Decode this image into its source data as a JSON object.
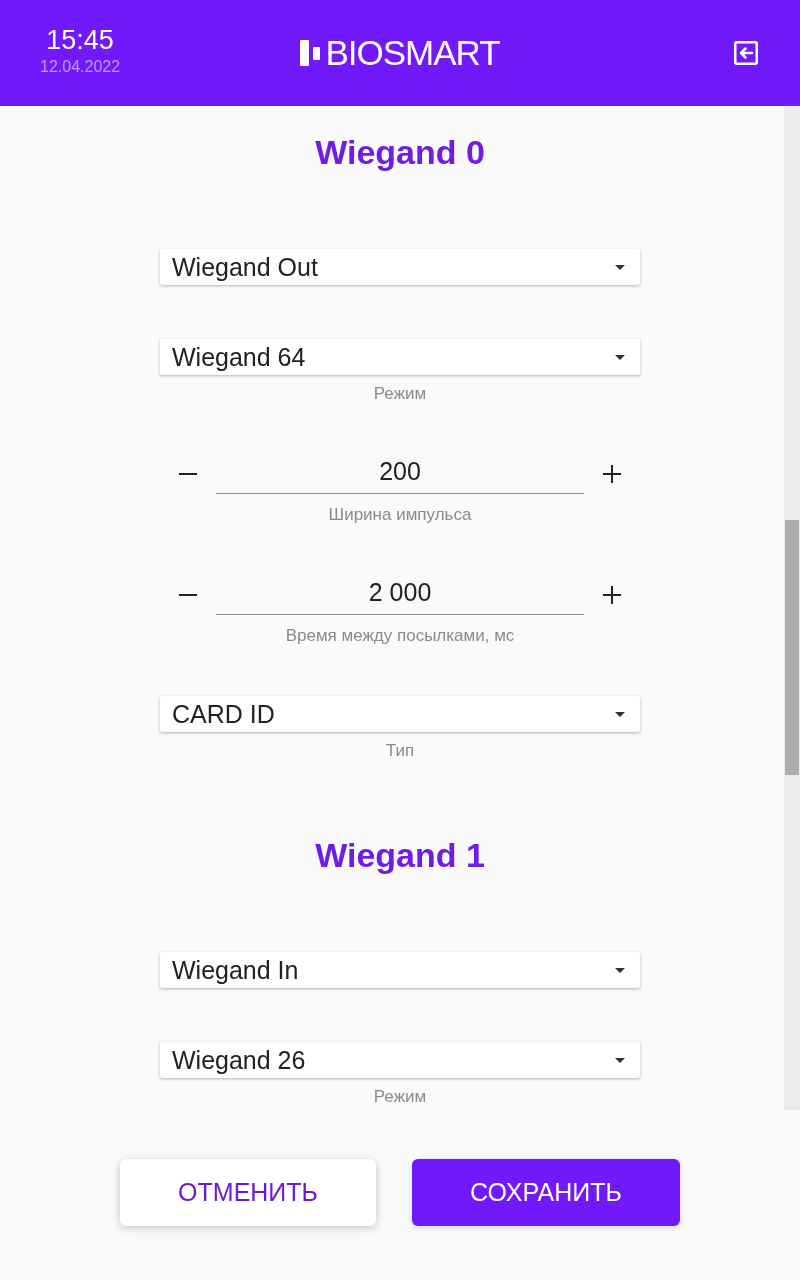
{
  "header": {
    "time": "15:45",
    "date": "12.04.2022",
    "logo": "BIOSMART"
  },
  "sections": [
    {
      "title": "Wiegand 0",
      "fields": [
        {
          "kind": "select",
          "value": "Wiegand Out"
        },
        {
          "kind": "select",
          "value": "Wiegand 64",
          "caption": "Режим"
        },
        {
          "kind": "stepper",
          "value": "200",
          "caption": "Ширина импульса"
        },
        {
          "kind": "stepper",
          "value": "2 000",
          "caption": "Время между посылками, мс"
        },
        {
          "kind": "select",
          "value": "CARD ID",
          "caption": "Тип"
        }
      ]
    },
    {
      "title": "Wiegand 1",
      "fields": [
        {
          "kind": "select",
          "value": "Wiegand In"
        },
        {
          "kind": "select",
          "value": "Wiegand 26",
          "caption": "Режим"
        }
      ]
    }
  ],
  "buttons": [
    {
      "label": "ОТМЕНИТЬ",
      "kind": "secondary"
    },
    {
      "label": "СОХРАНИТЬ",
      "kind": "primary"
    }
  ]
}
